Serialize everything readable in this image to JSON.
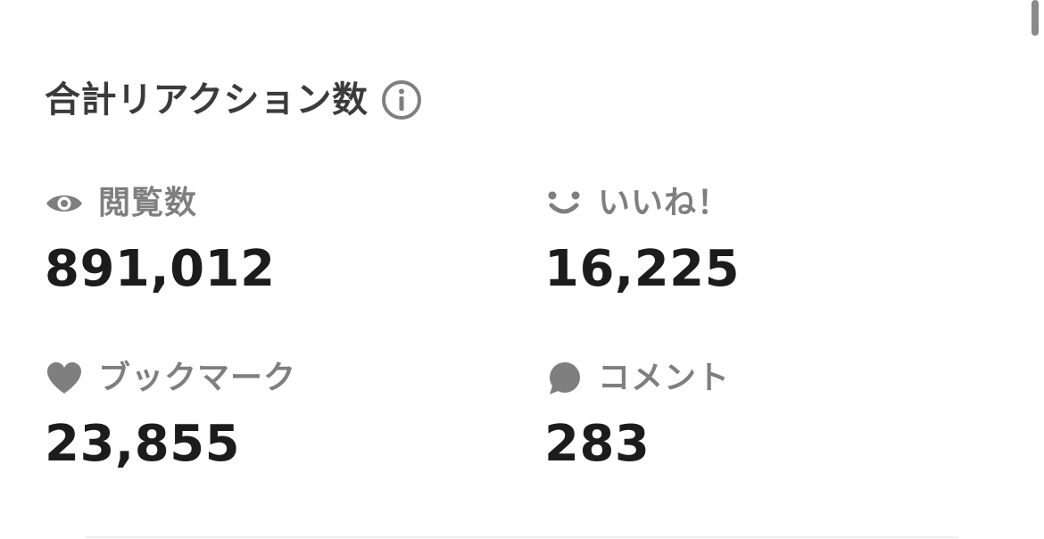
{
  "section": {
    "title": "合計リアクション数",
    "info_icon": "info-circle-icon"
  },
  "stats": {
    "views": {
      "icon": "eye-icon",
      "label": "閲覧数",
      "value": "891,012"
    },
    "likes": {
      "icon": "smile-icon",
      "label": "いいね！",
      "value": "16,225"
    },
    "bookmarks": {
      "icon": "heart-icon",
      "label": "ブックマーク",
      "value": "23,855"
    },
    "comments": {
      "icon": "speech-bubble-icon",
      "label": "コメント",
      "value": "283"
    }
  },
  "colors": {
    "title": "#3b3b3b",
    "label": "#7f7f7f",
    "value": "#1c1c1c",
    "icon": "#7f7f7f",
    "background": "#ffffff"
  }
}
